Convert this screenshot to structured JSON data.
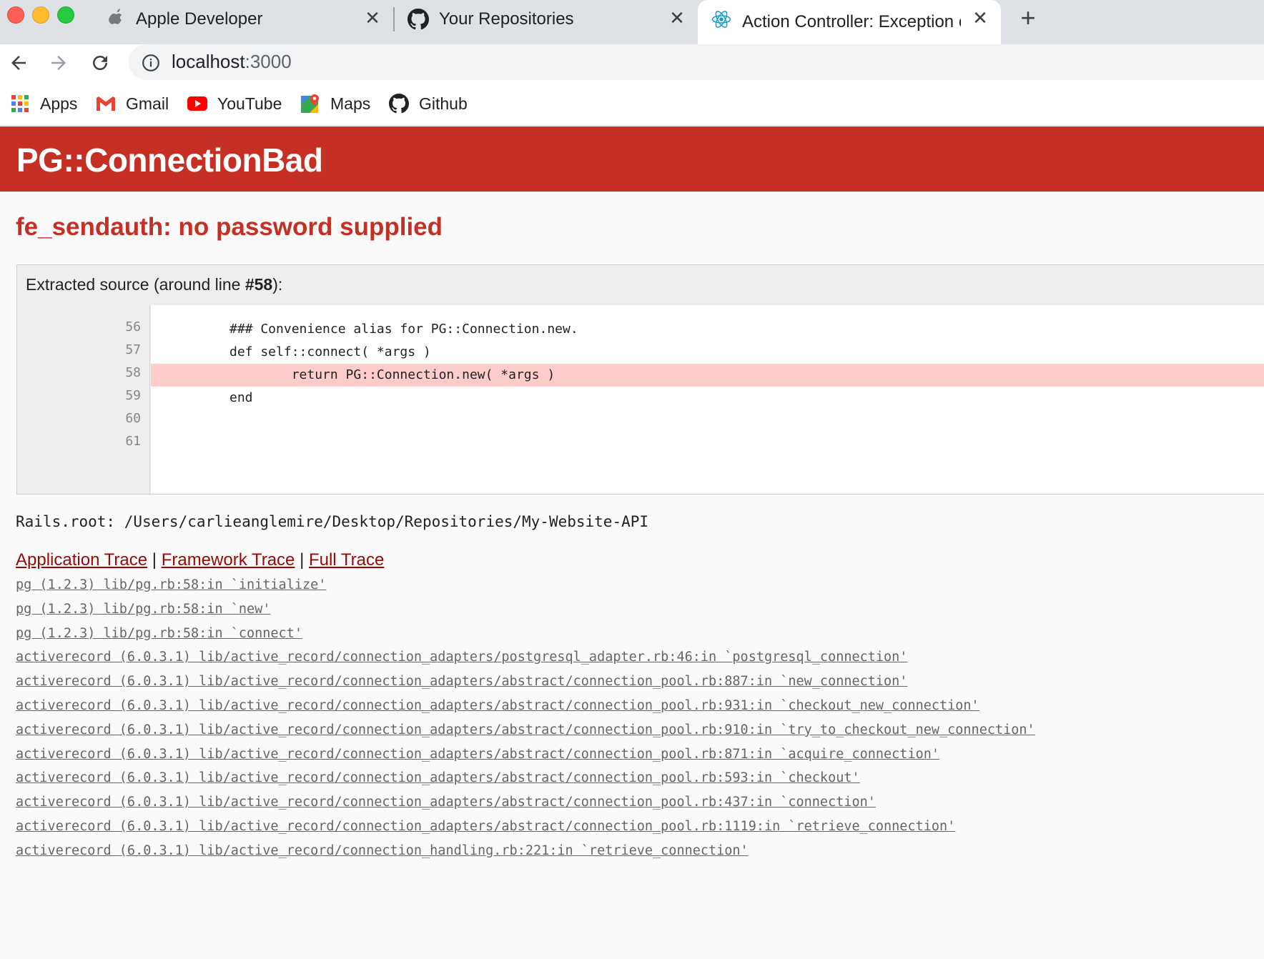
{
  "browser": {
    "tabs": [
      {
        "title": "Apple Developer",
        "icon": "apple-icon",
        "active": false
      },
      {
        "title": "Your Repositories",
        "icon": "github-icon",
        "active": false
      },
      {
        "title": "Action Controller: Exception ca",
        "icon": "react-icon",
        "active": true
      }
    ],
    "close_glyph": "✕",
    "new_tab_glyph": "+",
    "url_host": "localhost",
    "url_port": ":3000",
    "bookmarks": [
      {
        "label": "Apps",
        "icon": "apps-grid-icon"
      },
      {
        "label": "Gmail",
        "icon": "gmail-icon"
      },
      {
        "label": "YouTube",
        "icon": "youtube-icon"
      },
      {
        "label": "Maps",
        "icon": "maps-icon"
      },
      {
        "label": "Github",
        "icon": "github-icon"
      }
    ]
  },
  "error": {
    "title": "PG::ConnectionBad",
    "message": "fe_sendauth: no password supplied",
    "source": {
      "title_prefix": "Extracted source (around line ",
      "title_line": "#58",
      "title_suffix": "):",
      "lines": [
        {
          "num": "56",
          "text": "### Convenience alias for PG::Connection.new.",
          "highlight": false
        },
        {
          "num": "57",
          "text": "def self::connect( *args )",
          "highlight": false
        },
        {
          "num": "58",
          "text": "        return PG::Connection.new( *args )",
          "highlight": true
        },
        {
          "num": "59",
          "text": "end",
          "highlight": false
        },
        {
          "num": "60",
          "text": "",
          "highlight": false
        },
        {
          "num": "61",
          "text": "",
          "highlight": false
        }
      ]
    },
    "rails_root": "Rails.root: /Users/carlieanglemire/Desktop/Repositories/My-Website-API",
    "trace_links": {
      "application": "Application Trace",
      "framework": "Framework Trace",
      "full": "Full Trace",
      "separator": "|"
    },
    "trace": [
      "pg (1.2.3) lib/pg.rb:58:in `initialize'",
      "pg (1.2.3) lib/pg.rb:58:in `new'",
      "pg (1.2.3) lib/pg.rb:58:in `connect'",
      "activerecord (6.0.3.1) lib/active_record/connection_adapters/postgresql_adapter.rb:46:in `postgresql_connection'",
      "activerecord (6.0.3.1) lib/active_record/connection_adapters/abstract/connection_pool.rb:887:in `new_connection'",
      "activerecord (6.0.3.1) lib/active_record/connection_adapters/abstract/connection_pool.rb:931:in `checkout_new_connection'",
      "activerecord (6.0.3.1) lib/active_record/connection_adapters/abstract/connection_pool.rb:910:in `try_to_checkout_new_connection'",
      "activerecord (6.0.3.1) lib/active_record/connection_adapters/abstract/connection_pool.rb:871:in `acquire_connection'",
      "activerecord (6.0.3.1) lib/active_record/connection_adapters/abstract/connection_pool.rb:593:in `checkout'",
      "activerecord (6.0.3.1) lib/active_record/connection_adapters/abstract/connection_pool.rb:437:in `connection'",
      "activerecord (6.0.3.1) lib/active_record/connection_adapters/abstract/connection_pool.rb:1119:in `retrieve_connection'",
      "activerecord (6.0.3.1) lib/active_record/connection_handling.rb:221:in `retrieve_connection'"
    ]
  },
  "colors": {
    "rails_red": "#c52f24",
    "link_red": "#980905",
    "highlight_line": "#ffcccc"
  }
}
